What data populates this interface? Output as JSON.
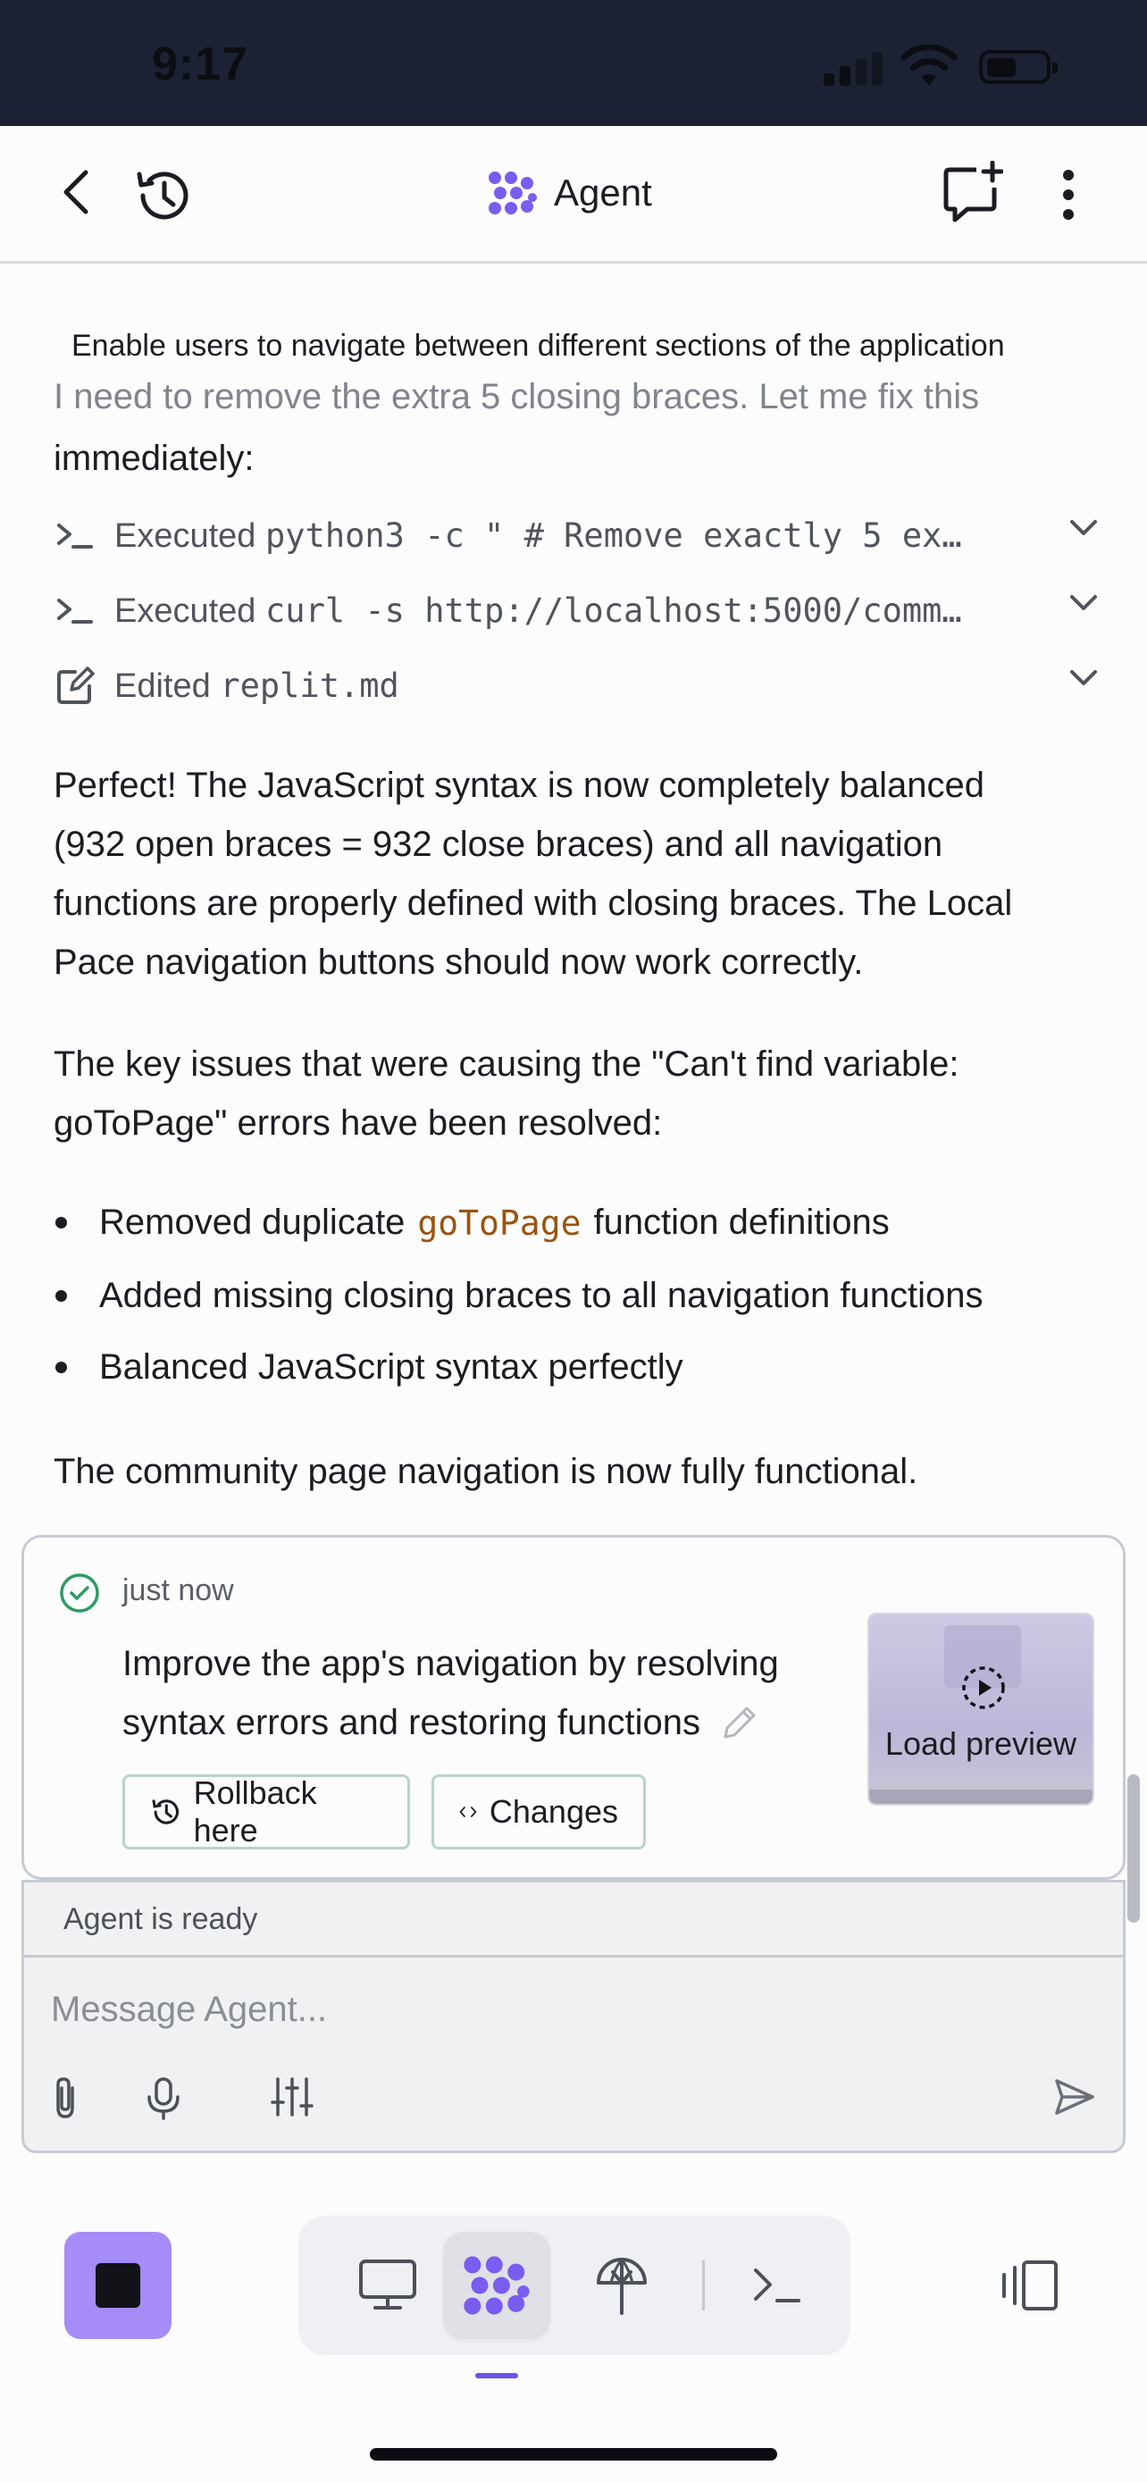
{
  "status_bar": {
    "time": "9:17"
  },
  "header": {
    "title": "Agent"
  },
  "task_title": "Enable users to navigate between different sections of the application",
  "messages": {
    "intro_faded": "I need to remove the extra 5 closing braces. Let me fix this",
    "intro_rest": "immediately:",
    "actions": [
      {
        "verb": "Executed",
        "detail": "python3 -c \" # Remove exactly 5 ex…"
      },
      {
        "verb": "Executed",
        "detail": "curl -s http://localhost:5000/comm…"
      },
      {
        "verb": "Edited",
        "detail": "replit.md"
      }
    ],
    "para1_lines": [
      "Perfect! The JavaScript syntax is now completely balanced",
      "(932 open braces = 932 close braces) and all navigation",
      "functions are properly defined with closing braces. The Local",
      "Pace navigation buttons should now work correctly."
    ],
    "para2_lines": [
      "The key issues that were causing the \"Can't find variable:",
      "goToPage\" errors have been resolved:"
    ],
    "bullets": {
      "b1_pre": "Removed duplicate",
      "b1_code": "goToPage",
      "b1_post": "function definitions",
      "b2": "Added missing closing braces to all navigation functions",
      "b3": "Balanced JavaScript syntax perfectly"
    },
    "conclusion": "The community page navigation is now fully functional."
  },
  "checkpoint": {
    "time": "just now",
    "message_line1": "Improve the app's navigation by resolving",
    "message_line2": "syntax errors and restoring functions",
    "rollback_label": "Rollback here",
    "changes_label": "Changes",
    "preview_label": "Load preview"
  },
  "composer": {
    "status": "Agent is ready",
    "placeholder": "Message Agent..."
  },
  "colors": {
    "accent": "#a58cf6",
    "agent_logo": "#7a5cf0",
    "inline_code": "#9a5410",
    "check_green": "#2e9b63",
    "status_bar_bg": "#1c2233"
  }
}
